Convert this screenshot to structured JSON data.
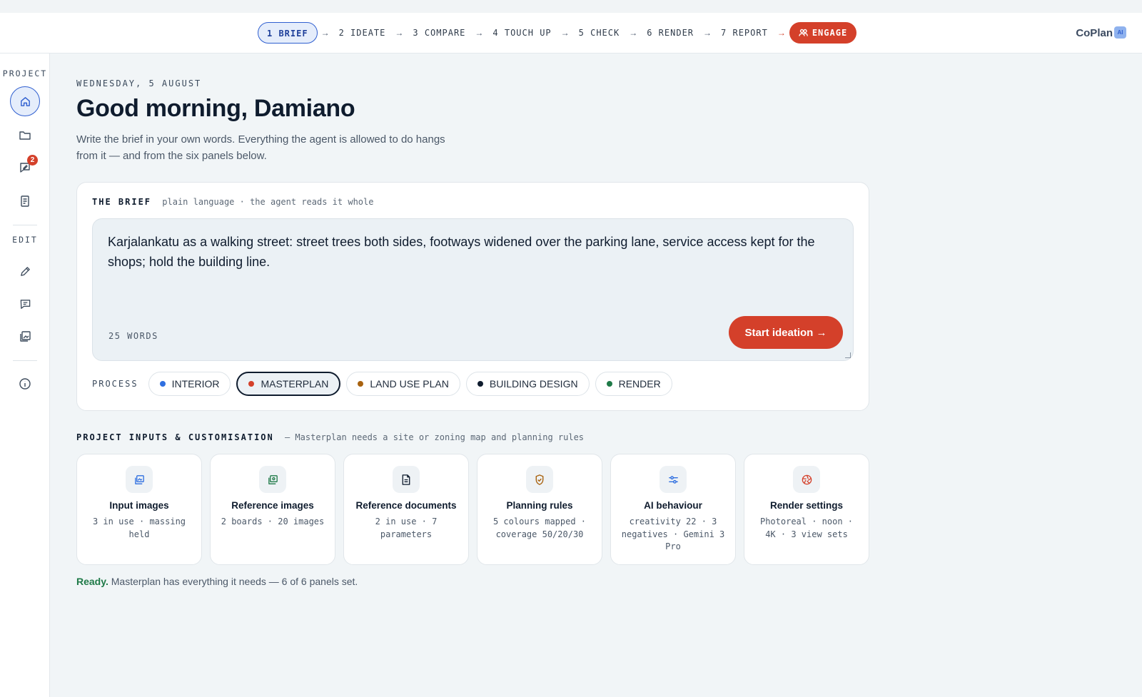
{
  "topbar": {
    "steps": [
      {
        "label": "1 BRIEF"
      },
      {
        "label": "2 IDEATE"
      },
      {
        "label": "3 COMPARE"
      },
      {
        "label": "4 TOUCH UP"
      },
      {
        "label": "5 CHECK"
      },
      {
        "label": "6 RENDER"
      },
      {
        "label": "7 REPORT"
      }
    ],
    "arrow": "→",
    "engage_label": "ENGAGE",
    "logo_text": "CoPlan",
    "logo_badge": "AI"
  },
  "sidebar": {
    "project_label": "PROJECT",
    "edit_label": "EDIT",
    "notification_count": "2",
    "icons": [
      "home-icon",
      "folder-icon",
      "chat-edit-icon",
      "document-icon",
      "pencil-icon",
      "comment-icon",
      "images-icon",
      "info-icon"
    ]
  },
  "header": {
    "date": "WEDNESDAY, 5 AUGUST",
    "greeting": "Good morning, Damiano",
    "lead": "Write the brief in your own words. Everything the agent is allowed to do hangs from it — and from the six panels below."
  },
  "brief": {
    "title": "THE BRIEF",
    "subtitle": "plain language · the agent reads it whole",
    "text": "Karjalankatu as a walking street: street trees both sides, footways widened over the parking lane, service access kept for the shops; hold the building line.",
    "word_count": "25 WORDS",
    "start_label": "Start ideation →"
  },
  "process": {
    "label": "PROCESS",
    "options": [
      {
        "label": "INTERIOR",
        "color": "#2f6fe0"
      },
      {
        "label": "MASTERPLAN",
        "color": "#d4402a",
        "selected": true
      },
      {
        "label": "LAND USE PLAN",
        "color": "#a8620f"
      },
      {
        "label": "BUILDING DESIGN",
        "color": "#0f1c2e"
      },
      {
        "label": "RENDER",
        "color": "#1f7a48"
      }
    ]
  },
  "inputs": {
    "title": "PROJECT INPUTS & CUSTOMISATION",
    "subtitle": "— Masterplan needs a site or zoning map and planning rules",
    "panels": [
      {
        "title": "Input images",
        "detail": "3 in use · massing held",
        "icon": "image-icon",
        "color": "#2f6fe0"
      },
      {
        "title": "Reference images",
        "detail": "2 boards · 20 images",
        "icon": "gallery-icon",
        "color": "#1f7a48"
      },
      {
        "title": "Reference documents",
        "detail": "2 in use · 7 parameters",
        "icon": "document-icon",
        "color": "#0f1c2e"
      },
      {
        "title": "Planning rules",
        "detail": "5 colours mapped · coverage 50/20/30",
        "icon": "shield-check-icon",
        "color": "#a8620f"
      },
      {
        "title": "AI behaviour",
        "detail": "creativity 22 · 3 negatives · Gemini 3 Pro",
        "icon": "sliders-icon",
        "color": "#2f6fe0"
      },
      {
        "title": "Render settings",
        "detail": "Photoreal · noon · 4K · 3 view sets",
        "icon": "aperture-icon",
        "color": "#d4402a"
      }
    ]
  },
  "status": {
    "ready_label": "Ready.",
    "message": "Masterplan has everything it needs — 6 of 6 panels set."
  }
}
